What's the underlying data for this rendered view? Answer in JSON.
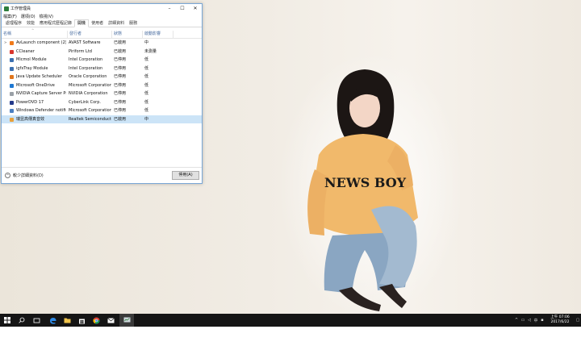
{
  "window": {
    "title": "工作管理員",
    "minimize": "–",
    "maximize": "☐",
    "close": "✕"
  },
  "menu": [
    "檔案(F)",
    "選項(O)",
    "檢視(V)"
  ],
  "tabs": [
    {
      "label": "處理程序",
      "active": false
    },
    {
      "label": "效能",
      "active": false
    },
    {
      "label": "應用程式歷程記錄",
      "active": false
    },
    {
      "label": "開機",
      "active": true
    },
    {
      "label": "使用者",
      "active": false
    },
    {
      "label": "詳細資料",
      "active": false
    },
    {
      "label": "服務",
      "active": false
    }
  ],
  "columns": [
    "名稱",
    "發行者",
    "狀態",
    "啟動影響"
  ],
  "rows": [
    {
      "name": "AvLaunch component (2)",
      "publisher": "AVAST Software",
      "status": "已啟用",
      "impact": "中",
      "expandable": true,
      "icon_color": "#f07a1a",
      "selected": false
    },
    {
      "name": "CCleaner",
      "publisher": "Piriform Ltd",
      "status": "已啟用",
      "impact": "未測量",
      "expandable": false,
      "icon_color": "#d9342b",
      "selected": false
    },
    {
      "name": "Micmol Module",
      "publisher": "Intel Corporation",
      "status": "已停用",
      "impact": "低",
      "expandable": false,
      "icon_color": "#3a6fb0",
      "selected": false
    },
    {
      "name": "igfxTray Module",
      "publisher": "Intel Corporation",
      "status": "已停用",
      "impact": "低",
      "expandable": false,
      "icon_color": "#3a6fb0",
      "selected": false
    },
    {
      "name": "Java Update Scheduler",
      "publisher": "Oracle Corporation",
      "status": "已停用",
      "impact": "低",
      "expandable": false,
      "icon_color": "#e0761c",
      "selected": false
    },
    {
      "name": "Microsoft OneDrive",
      "publisher": "Microsoft Corporation",
      "status": "已停用",
      "impact": "低",
      "expandable": false,
      "icon_color": "#1e78d2",
      "selected": false
    },
    {
      "name": "NVIDIA Capture Server Pro...",
      "publisher": "NVIDIA Corporation",
      "status": "已停用",
      "impact": "低",
      "expandable": false,
      "icon_color": "#9aa0a6",
      "selected": false
    },
    {
      "name": "PowerDVD 17",
      "publisher": "CyberLink Corp.",
      "status": "已停用",
      "impact": "低",
      "expandable": false,
      "icon_color": "#243a8a",
      "selected": false
    },
    {
      "name": "Windows Defender notific...",
      "publisher": "Microsoft Corporation",
      "status": "已停用",
      "impact": "低",
      "expandable": false,
      "icon_color": "#4a7fc1",
      "selected": false
    },
    {
      "name": "瑞昱高傳真音效",
      "publisher": "Realtek Semiconductor",
      "status": "已啟用",
      "impact": "中",
      "expandable": false,
      "icon_color": "#e8a03a",
      "selected": true
    }
  ],
  "footer": {
    "fewer_details": "較少詳細資料(D)",
    "disable_button": "停用(A)"
  },
  "taskbar": {
    "items": [
      "start-icon",
      "search-icon",
      "task-view-icon",
      "edge-icon",
      "file-explorer-icon",
      "store-icon",
      "chrome-icon",
      "mail-icon",
      "task-manager-icon"
    ],
    "tray_icons": [
      "chevron-up-icon",
      "network-icon",
      "volume-icon",
      "ime-icon",
      "keyboard-icon"
    ],
    "ime_label": "中",
    "time": "上午 07:06",
    "date": "2017/6/22"
  },
  "colors": {
    "accent": "#0078d7",
    "selection": "#cce4f7",
    "taskbar": "#151515"
  }
}
